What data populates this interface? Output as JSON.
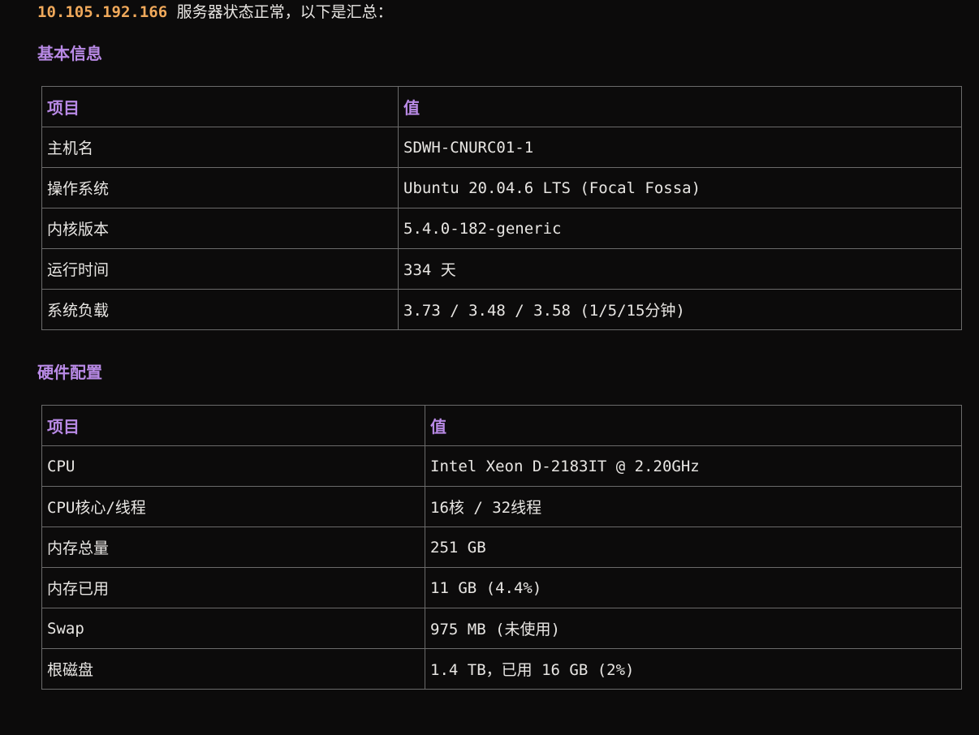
{
  "summary": {
    "ip": "10.105.192.166",
    "text": " 服务器状态正常，以下是汇总："
  },
  "basic": {
    "title": "基本信息",
    "headers": [
      "项目",
      "值"
    ],
    "rows": [
      [
        "主机名",
        "SDWH-CNURC01-1"
      ],
      [
        "操作系统",
        "Ubuntu 20.04.6 LTS (Focal Fossa)"
      ],
      [
        "内核版本",
        "5.4.0-182-generic"
      ],
      [
        "运行时间",
        "334 天"
      ],
      [
        "系统负载",
        "3.73 / 3.48 / 3.58 (1/5/15分钟)"
      ]
    ]
  },
  "hardware": {
    "title": "硬件配置",
    "headers": [
      "项目",
      "值"
    ],
    "rows": [
      [
        "CPU",
        "Intel Xeon D-2183IT @ 2.20GHz"
      ],
      [
        "CPU核心/线程",
        "16核 / 32线程"
      ],
      [
        "内存总量",
        "251 GB"
      ],
      [
        "内存已用",
        "11 GB (4.4%)"
      ],
      [
        "Swap",
        "975 MB (未使用)"
      ],
      [
        "根磁盘",
        "1.4 TB，已用 16 GB (2%)"
      ]
    ]
  }
}
